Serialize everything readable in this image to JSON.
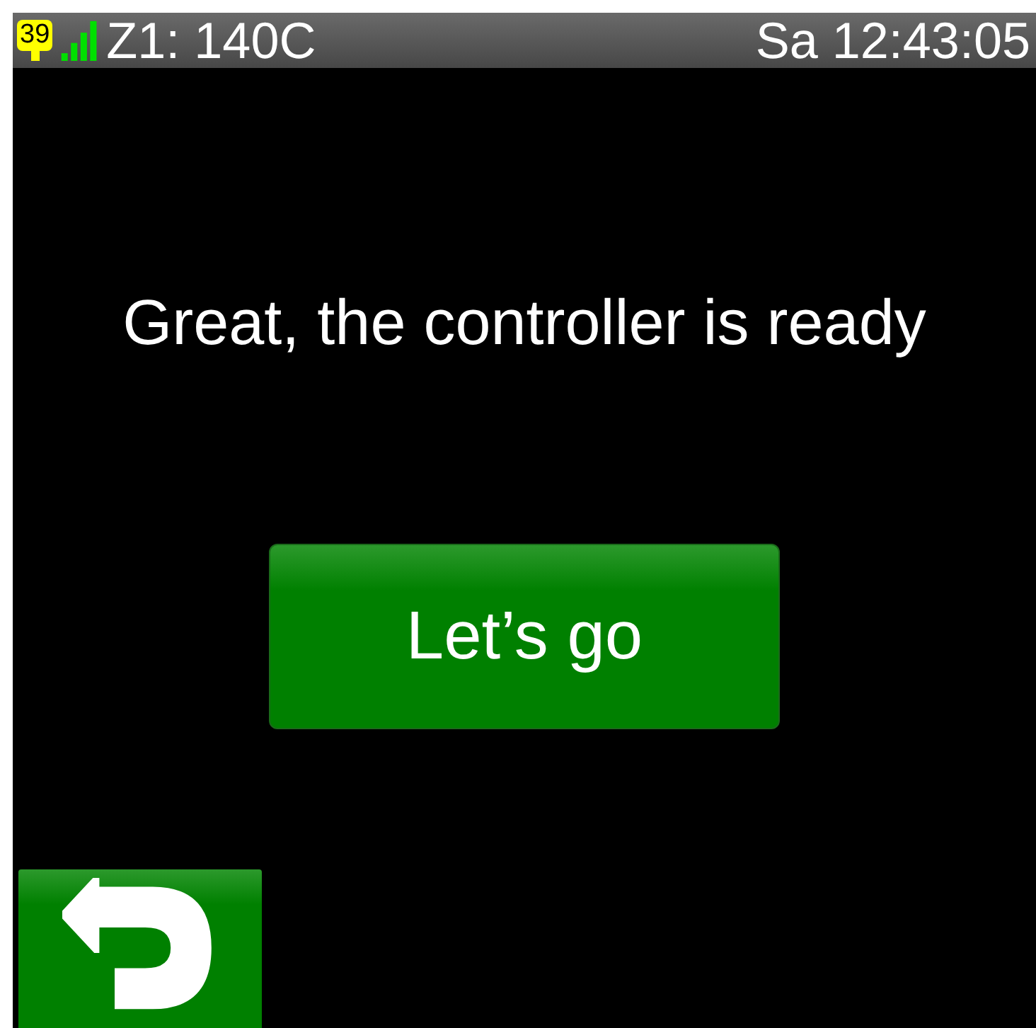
{
  "status_bar": {
    "badge": "39",
    "zone": "Z1: 140C",
    "clock": "Sa 12:43:05"
  },
  "message": "Great, the controller is ready",
  "primary_button": {
    "label": "Let’s go"
  },
  "back_button": {
    "kind": "back"
  }
}
